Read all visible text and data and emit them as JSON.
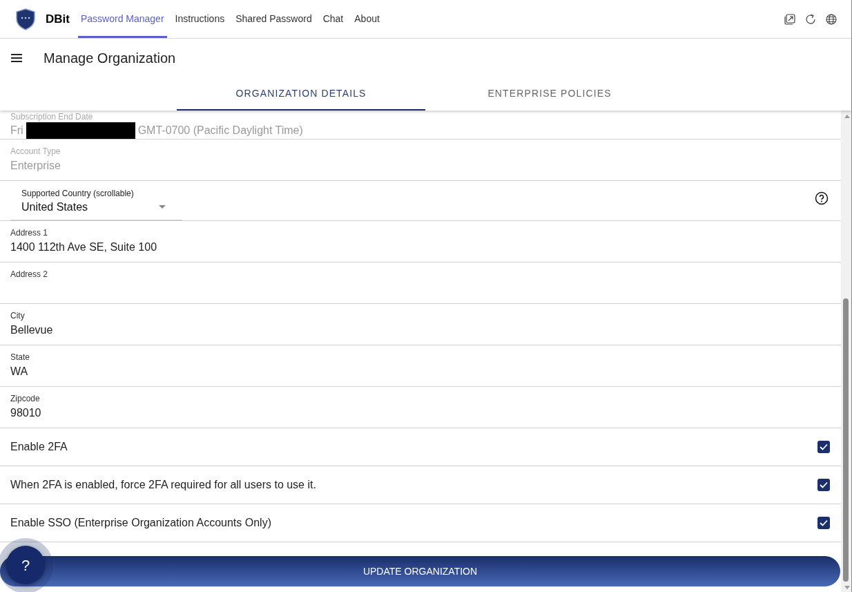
{
  "header": {
    "brand": "DBit",
    "nav": [
      {
        "label": "Password Manager",
        "selected": true
      },
      {
        "label": "Instructions",
        "selected": false
      },
      {
        "label": "Shared Password",
        "selected": false
      },
      {
        "label": "Chat",
        "selected": false
      },
      {
        "label": "About",
        "selected": false
      }
    ]
  },
  "page": {
    "title": "Manage Organization"
  },
  "tabs": [
    {
      "label": "ORGANIZATION DETAILS",
      "selected": true
    },
    {
      "label": "ENTERPRISE POLICIES",
      "selected": false
    }
  ],
  "fields": [
    {
      "kind": "text",
      "label": "Subscription End Date",
      "value": "Fri",
      "value_after": "GMT-0700 (Pacific Daylight Time)",
      "redacted": true,
      "disabled": true
    },
    {
      "kind": "text",
      "label": "Account Type",
      "value": "Enterprise",
      "disabled": true
    },
    {
      "kind": "select",
      "label": "Supported Country (scrollable)",
      "value": "United States",
      "help": true
    },
    {
      "kind": "text",
      "label": "Address 1",
      "value": "1400 112th Ave SE, Suite 100",
      "disabled": false
    },
    {
      "kind": "text",
      "label": "Address 2",
      "disabled": false
    },
    {
      "kind": "text",
      "label": "City",
      "value": "Bellevue",
      "disabled": false
    },
    {
      "kind": "text",
      "label": "State",
      "value": "WA",
      "disabled": false
    },
    {
      "kind": "text",
      "label": "Zipcode",
      "value": "98010",
      "disabled": false
    },
    {
      "kind": "checkbox",
      "label": "Enable 2FA",
      "checked": true
    },
    {
      "kind": "checkbox",
      "label": "When 2FA is enabled, force 2FA required for all users to use it.",
      "checked": true
    },
    {
      "kind": "checkbox",
      "label": "Enable SSO (Enterprise Organization Accounts Only)",
      "checked": true
    }
  ],
  "submit": {
    "label": "UPDATE ORGANIZATION"
  },
  "help_button": {
    "label": "?"
  }
}
